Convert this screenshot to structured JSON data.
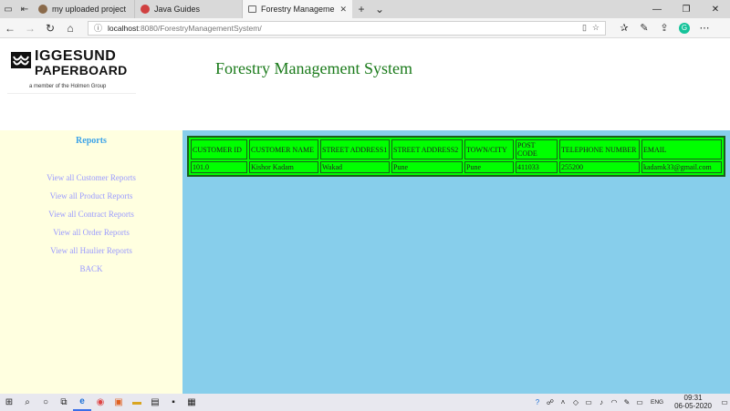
{
  "browser": {
    "tabs": [
      {
        "title": "my uploaded project list.do",
        "icon_color": "#8a6a4a",
        "active": false
      },
      {
        "title": "Java Guides",
        "icon_color": "#d04040",
        "active": false
      },
      {
        "title": "Forestry Management S",
        "icon_color": "#666666",
        "active": true
      }
    ],
    "url_host": "localhost",
    "url_path": ":8080/ForestryManagementSystem/"
  },
  "header": {
    "logo_line1": "IGGESUND",
    "logo_line2": "PAPERBOARD",
    "logo_line3": "a member of the Holmen Group",
    "title": "Forestry Management System"
  },
  "sidebar": {
    "title": "Reports",
    "items": [
      {
        "label": "View all Customer Reports"
      },
      {
        "label": "View all Product Reports"
      },
      {
        "label": "View all Contract Reports"
      },
      {
        "label": "View all Order Reports"
      },
      {
        "label": "View all Haulier Reports"
      },
      {
        "label": "BACK"
      }
    ]
  },
  "table": {
    "headers": [
      "CUSTOMER ID",
      "CUSTOMER NAME",
      "STREET ADDRESS1",
      "STREET ADDRESS2",
      "TOWN/CITY",
      "POST CODE",
      "TELEPHONE NUMBER",
      "EMAIL"
    ],
    "rows": [
      [
        "101.0",
        "Kishor Kadam",
        "Wakad",
        "Pune",
        "Pune",
        "411033",
        "255200",
        "kadamk33@gmail.com"
      ]
    ]
  },
  "taskbar": {
    "lang": "ENG",
    "time": "09:31",
    "date": "06-05-2020"
  },
  "colors": {
    "title_green": "#1a7a1a",
    "sidebar_bg": "#ffffe0",
    "content_bg": "#87ceeb",
    "table_bg": "#00ff00",
    "link": "#9a9aff",
    "reports_title": "#3da3e8"
  }
}
